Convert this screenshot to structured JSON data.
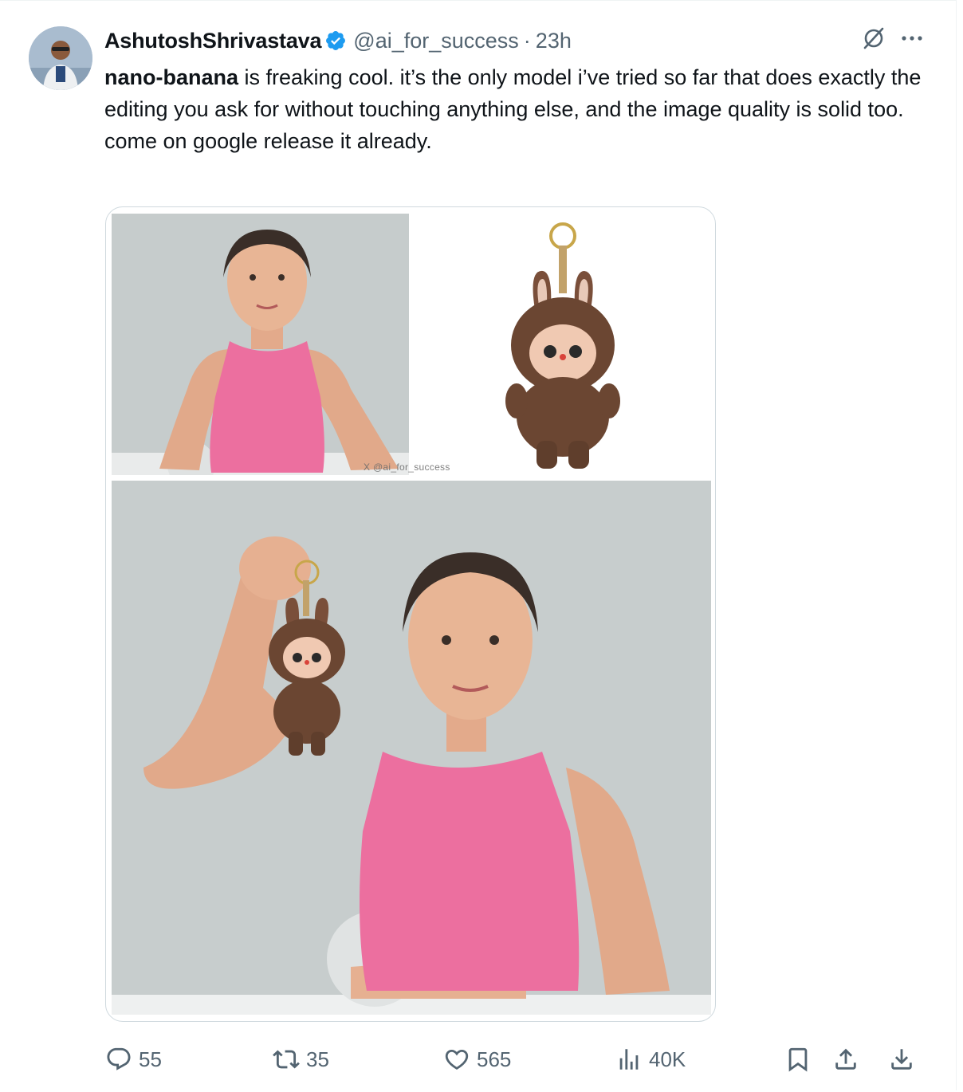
{
  "author": {
    "name": "AshutoshShrivastava",
    "handle": "@ai_for_success",
    "separator": "·",
    "time": "23h",
    "avatar_icon": "avatar-photo"
  },
  "tweet": {
    "bold_lead": "nano-banana",
    "line1_rest": " is freaking cool. it’s the only model i’ve tried so far that does exactly the editing you ask for without touching anything else, and the image quality is solid too.",
    "line2": "come on google release it already."
  },
  "media": {
    "watermark": "X @ai_for_success"
  },
  "actions": {
    "replies": "55",
    "reposts": "35",
    "likes": "565",
    "views": "40K"
  },
  "colors": {
    "verified": "#1d9bf0",
    "muted": "#536471",
    "text": "#0f1419",
    "border": "#cfd9de"
  }
}
